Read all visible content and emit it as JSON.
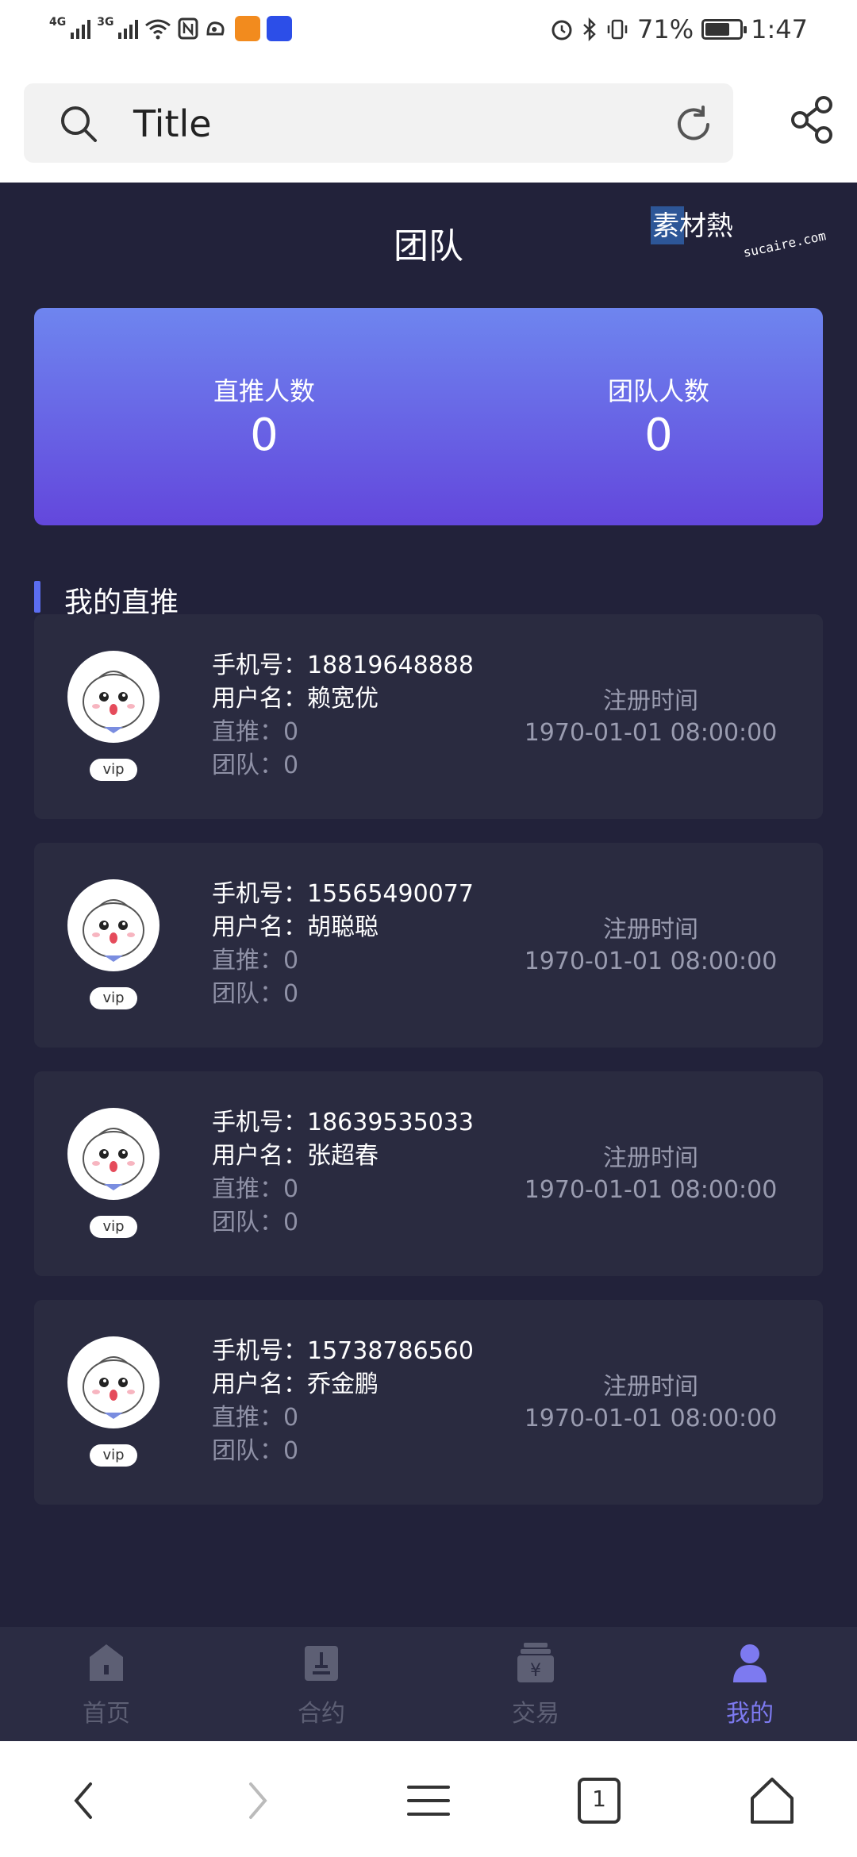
{
  "status_bar": {
    "signal1": "4G",
    "signal2": "3G",
    "battery": "71%",
    "battery_level": 0.71,
    "time": "1:47"
  },
  "browser": {
    "title": "Title",
    "search_icon": "search-icon",
    "reload_icon": "reload-icon",
    "share_icon": "share-icon"
  },
  "page": {
    "title": "团队",
    "watermark_main": "素材熱",
    "watermark_sub": "sucaire.com"
  },
  "stats": {
    "direct_label": "直推人数",
    "direct_value": "0",
    "team_label": "团队人数",
    "team_value": "0"
  },
  "section_title": "我的直推",
  "members": [
    {
      "phone": "手机号：18819648888",
      "username": "用户名：赖宽优",
      "direct": "直推：0",
      "team": "团队：0",
      "vip": "vip",
      "reg_label": "注册时间",
      "reg_time": "1970-01-01 08:00:00"
    },
    {
      "phone": "手机号：15565490077",
      "username": "用户名：胡聪聪",
      "direct": "直推：0",
      "team": "团队：0",
      "vip": "vip",
      "reg_label": "注册时间",
      "reg_time": "1970-01-01 08:00:00"
    },
    {
      "phone": "手机号：18639535033",
      "username": "用户名：张超春",
      "direct": "直推：0",
      "team": "团队：0",
      "vip": "vip",
      "reg_label": "注册时间",
      "reg_time": "1970-01-01 08:00:00"
    },
    {
      "phone": "手机号：15738786560",
      "username": "用户名：乔金鹏",
      "direct": "直推：0",
      "team": "团队：0",
      "vip": "vip",
      "reg_label": "注册时间",
      "reg_time": "1970-01-01 08:00:00"
    }
  ],
  "tabs": [
    {
      "label": "首页",
      "icon": "home-icon"
    },
    {
      "label": "合约",
      "icon": "contract-icon"
    },
    {
      "label": "交易",
      "icon": "trade-icon"
    },
    {
      "label": "我的",
      "icon": "profile-icon",
      "active": true
    }
  ],
  "nav": {
    "tabs_count": "1"
  },
  "colors": {
    "background": "#22223a",
    "card": "#2a2b40",
    "accent": "#7d7af0",
    "gradient_top": "#6e85ef",
    "gradient_bottom": "#6347dc"
  }
}
